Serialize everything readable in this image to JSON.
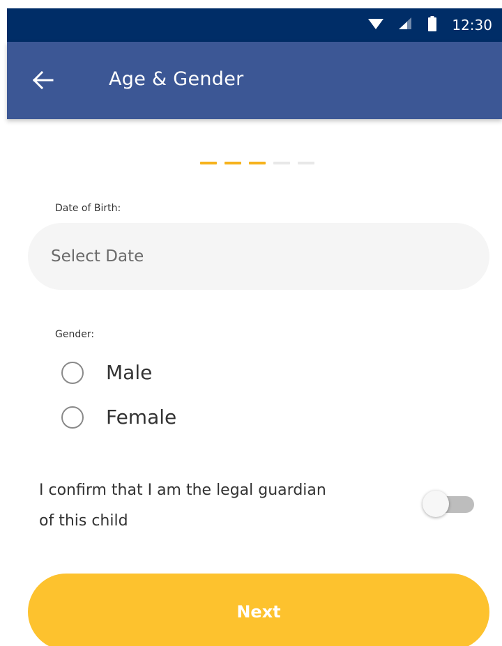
{
  "status_bar": {
    "time": "12:30",
    "background_color": "#002d67",
    "icons": [
      "wifi-icon",
      "signal-icon",
      "battery-icon"
    ]
  },
  "app_bar": {
    "title": "Age & Gender",
    "back_icon": "arrow-left-icon",
    "background_color": "#3c5795"
  },
  "progress": {
    "total_steps": 5,
    "completed_steps": 3,
    "active_color": "#f6b21c",
    "inactive_color": "#e8e8e8"
  },
  "form": {
    "dob_label": "Date of Birth:",
    "dob_placeholder": "Select Date",
    "gender_label": "Gender:",
    "gender_options": [
      {
        "label": "Male",
        "selected": false
      },
      {
        "label": "Female",
        "selected": false
      }
    ],
    "confirm_text_line1": "I confirm that I am the legal guardian",
    "confirm_text_line2": "of this child",
    "guardian_toggle_on": false
  },
  "next_button": {
    "label": "Next",
    "color": "#fdc22e"
  }
}
